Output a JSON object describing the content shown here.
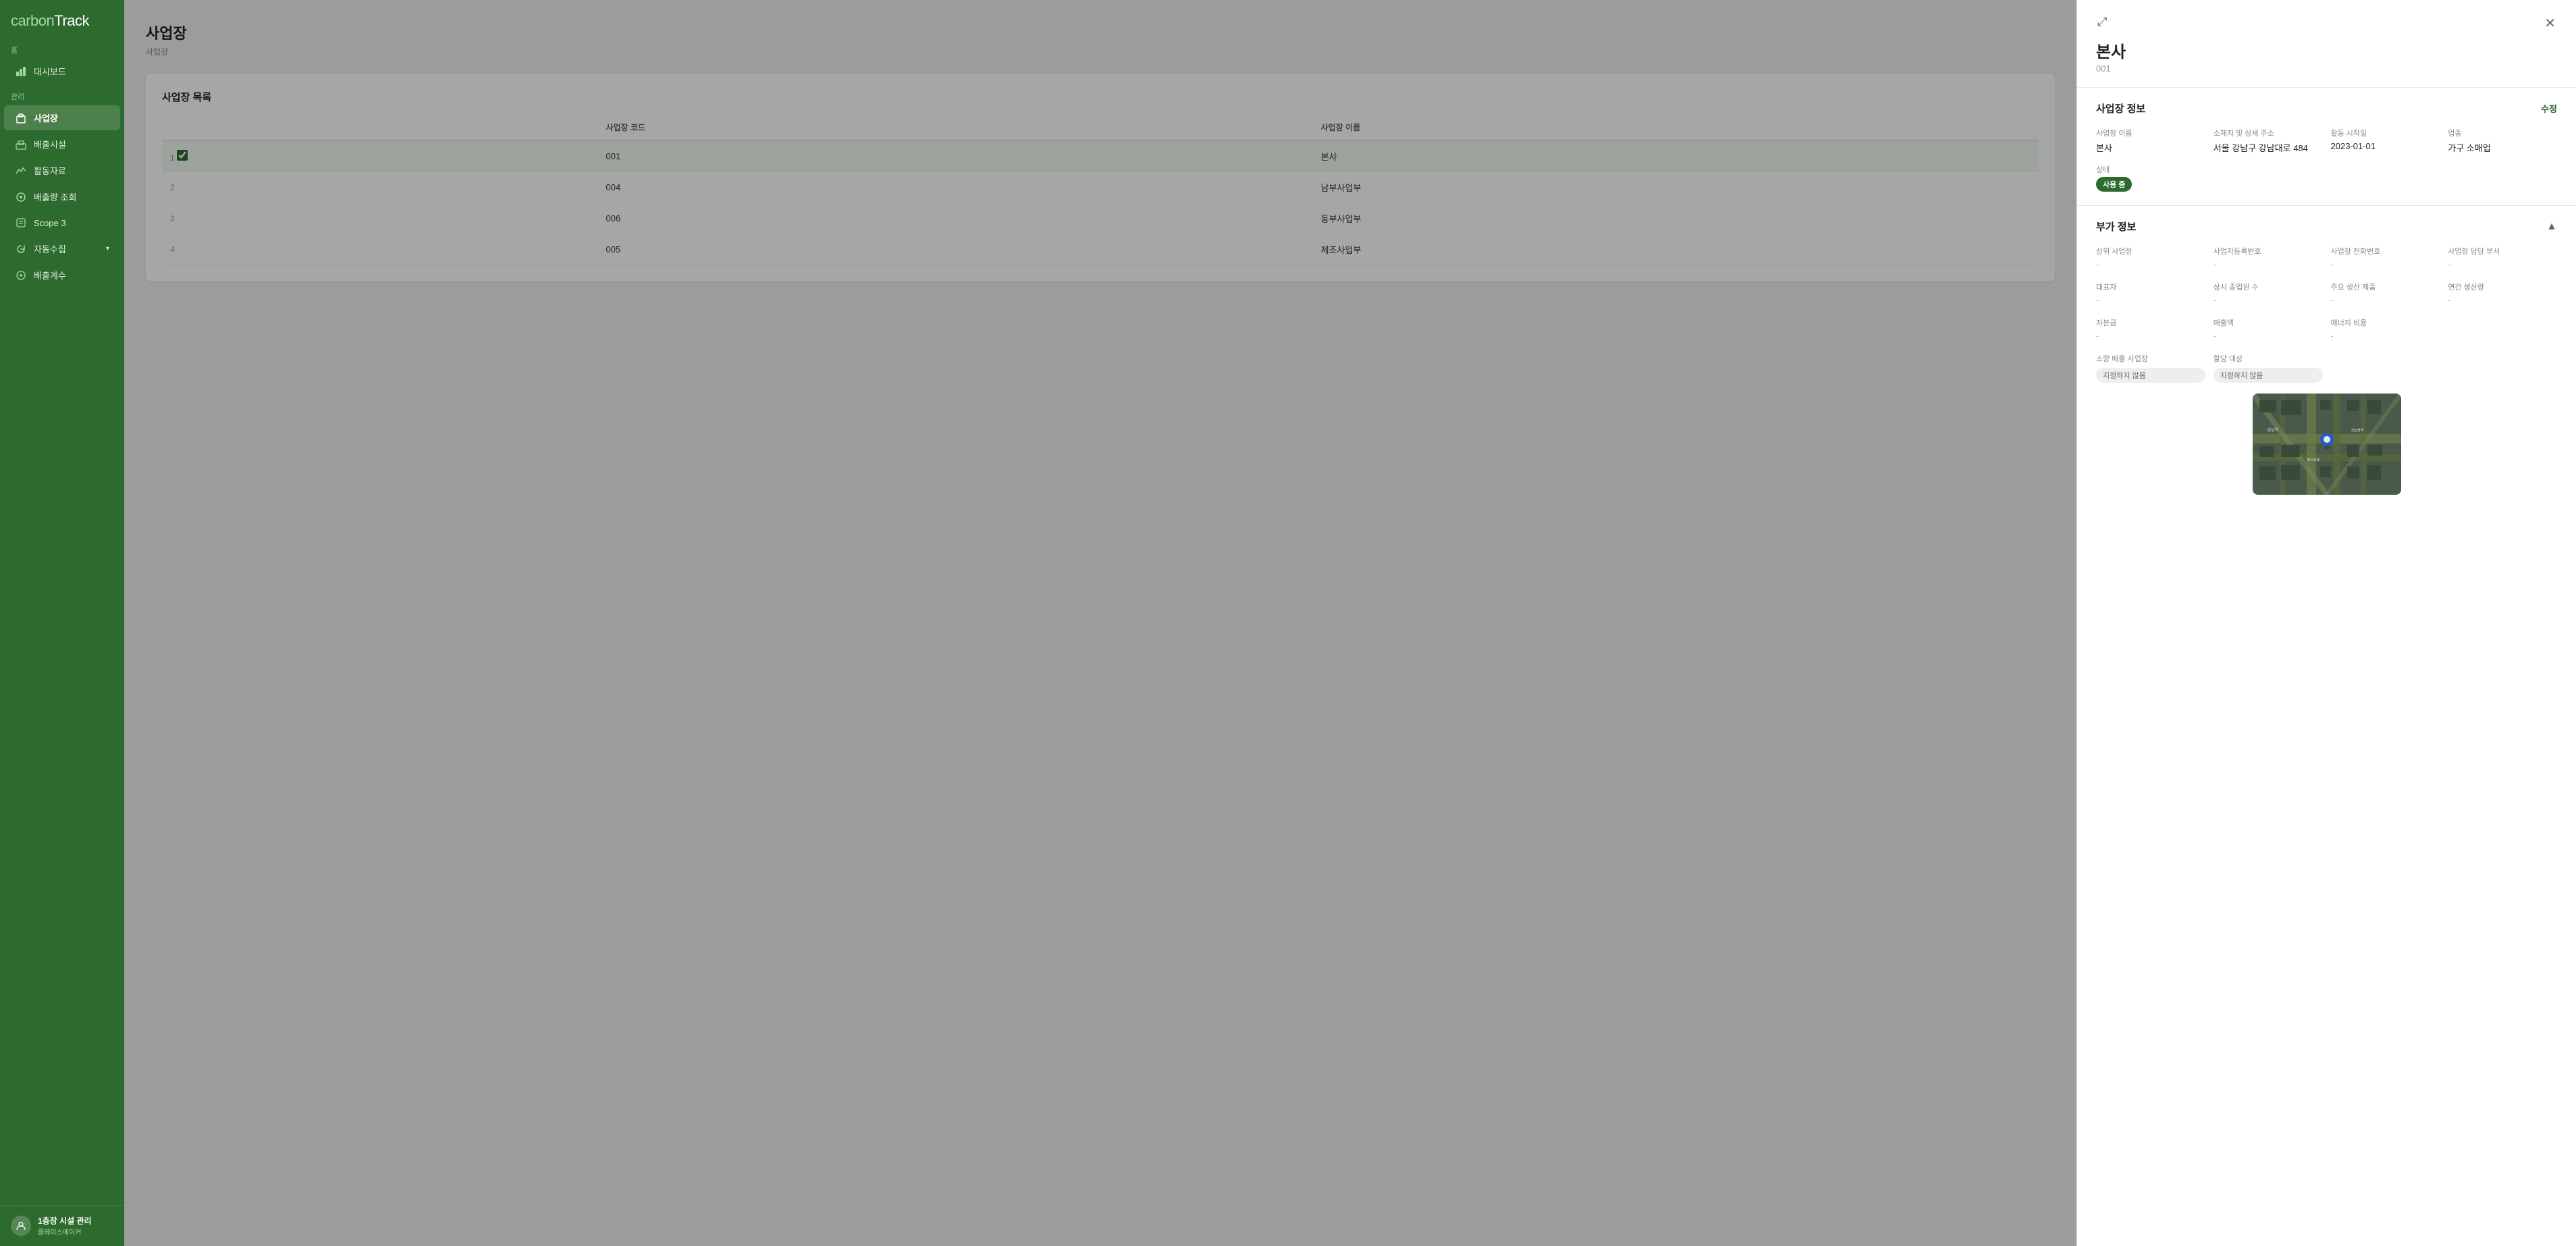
{
  "app": {
    "logo": "carbon",
    "logo_accent": "Track"
  },
  "sidebar": {
    "sections": [
      {
        "label": "홈",
        "items": [
          {
            "id": "dashboard",
            "label": "대시보드",
            "icon": "📊",
            "active": false
          }
        ]
      },
      {
        "label": "관리",
        "items": [
          {
            "id": "business",
            "label": "사업장",
            "icon": "🏢",
            "active": true
          },
          {
            "id": "facilities",
            "label": "배출시설",
            "icon": "🏭",
            "active": false
          },
          {
            "id": "activity",
            "label": "활동자료",
            "icon": "📈",
            "active": false
          },
          {
            "id": "emissions-view",
            "label": "배출량 조회",
            "icon": "🔍",
            "active": false
          },
          {
            "id": "scope3",
            "label": "Scope 3",
            "icon": "📋",
            "active": false
          },
          {
            "id": "auto-collect",
            "label": "자동수집",
            "icon": "🔄",
            "active": false,
            "has_chevron": true
          },
          {
            "id": "emission-calc",
            "label": "배출계수",
            "icon": "⚙️",
            "active": false
          }
        ]
      }
    ],
    "user": {
      "name": "1층장 시설 관리",
      "role": "플레이스메이커"
    }
  },
  "page": {
    "title": "사업장",
    "breadcrumb": "사업장"
  },
  "table": {
    "section_title": "사업장 목록",
    "columns": [
      "",
      "사업장 코드",
      "사업장 이름"
    ],
    "rows": [
      {
        "num": 1,
        "code": "001",
        "name": "본사",
        "selected": true
      },
      {
        "num": 2,
        "code": "004",
        "name": "남부사업부",
        "selected": false
      },
      {
        "num": 3,
        "code": "006",
        "name": "동부사업부",
        "selected": false
      },
      {
        "num": 4,
        "code": "005",
        "name": "제조사업부",
        "selected": false
      }
    ]
  },
  "detail": {
    "title": "본사",
    "code": "001",
    "expand_icon": "⤢",
    "close_icon": "✕",
    "sections": {
      "business_info": {
        "title": "사업장 정보",
        "edit_label": "수정",
        "fields": [
          {
            "label": "사업장 이름",
            "value": "본사",
            "key": "name"
          },
          {
            "label": "소재지 및 상세 주소",
            "value": "서울 강남구 강남대로 484",
            "key": "address"
          },
          {
            "label": "활동 시작일",
            "value": "2023-01-01",
            "key": "start_date"
          },
          {
            "label": "업종",
            "value": "가구 소매업",
            "key": "industry"
          }
        ],
        "status_label": "상태",
        "status_value": "사용 중",
        "status_badge_class": "active"
      },
      "additional_info": {
        "title": "부가 정보",
        "toggle": "▲",
        "fields": [
          {
            "label": "상위 사업장",
            "value": "-",
            "key": "parent"
          },
          {
            "label": "사업자등록번호",
            "value": "-",
            "key": "reg_num"
          },
          {
            "label": "사업장 전화번호",
            "value": "-",
            "key": "phone"
          },
          {
            "label": "사업장 담당 부서",
            "value": "-",
            "key": "dept"
          },
          {
            "label": "대표자",
            "value": "-",
            "key": "rep"
          },
          {
            "label": "상시 종업원 수",
            "value": "-",
            "key": "employees"
          },
          {
            "label": "주요 생산 제품",
            "value": "-",
            "key": "product"
          },
          {
            "label": "연간 생산량",
            "value": "-",
            "key": "annual_prod"
          },
          {
            "label": "자본금",
            "value": "-",
            "key": "capital"
          },
          {
            "label": "매출액",
            "value": "-",
            "key": "revenue"
          },
          {
            "label": "에너지 비용",
            "value": "-",
            "key": "energy_cost"
          },
          {
            "label": "소량 배출 사업장",
            "value": "지정하지 않음",
            "key": "small_emission",
            "badge": true
          },
          {
            "label": "할당 대상",
            "value": "지정하지 않음",
            "key": "allocation",
            "badge": true
          }
        ]
      }
    }
  }
}
